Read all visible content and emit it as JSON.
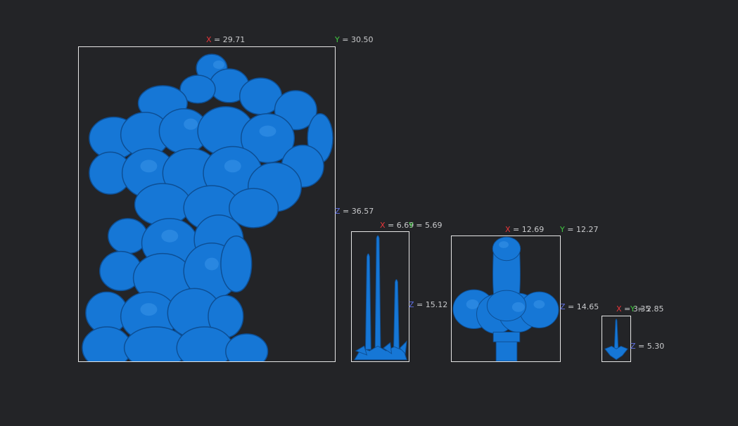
{
  "colors": {
    "background": "#232427",
    "model": "#1677d6",
    "model_shade": "#0d4f95",
    "box": "#e6e6e6",
    "axis_x": "#e8363a",
    "axis_y": "#40c840",
    "axis_z": "#5f6fe0",
    "label": "#c9cacc"
  },
  "axis_letters": {
    "x": "X",
    "y": "Y",
    "z": "Z"
  },
  "objects": [
    {
      "name": "tree-model",
      "x_value": "= 29.71",
      "y_value": "= 30.50",
      "z_value": "= 36.57"
    },
    {
      "name": "spikes-model",
      "x_value": "= 6.69",
      "y_value": "= 5.69",
      "z_value": "= 15.12"
    },
    {
      "name": "hilt-model",
      "x_value": "= 12.69",
      "y_value": "= 12.27",
      "z_value": "= 14.65"
    },
    {
      "name": "small-spike-model",
      "x_value": "= 3.35",
      "y_value": "= 2.85",
      "z_value": "= 5.30"
    }
  ]
}
